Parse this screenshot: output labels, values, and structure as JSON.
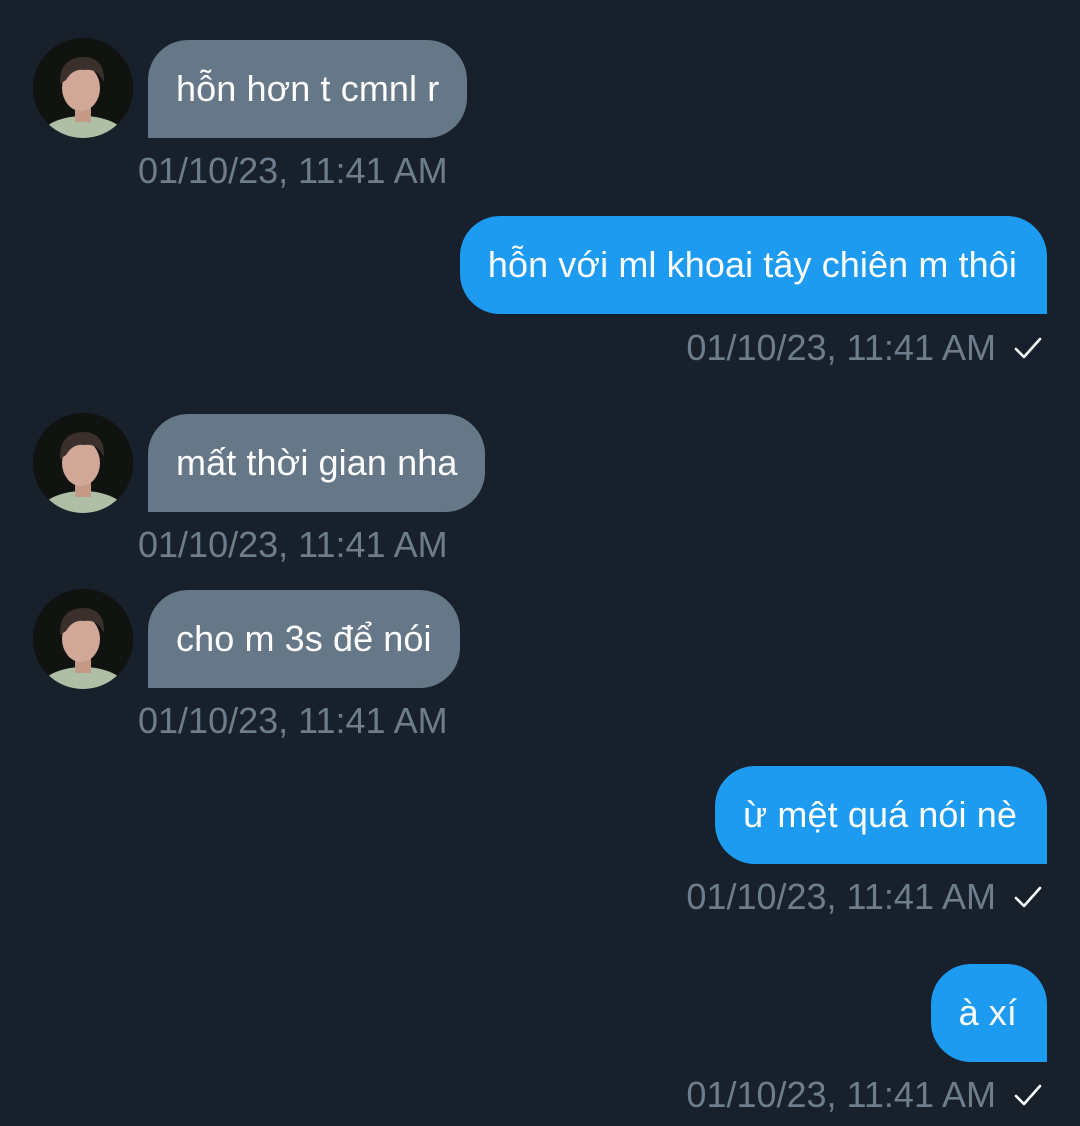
{
  "messages": [
    {
      "sender": "them",
      "text": "hỗn hơn t cmnl r",
      "timestamp": "01/10/23, 11:41 AM"
    },
    {
      "sender": "me",
      "text": "hỗn với ml khoai tây chiên m thôi",
      "timestamp": "01/10/23, 11:41 AM",
      "status_icon": "check-icon"
    },
    {
      "sender": "them",
      "text": "mất thời gian nha",
      "timestamp": "01/10/23, 11:41 AM"
    },
    {
      "sender": "them",
      "text": "cho m 3s để nói",
      "timestamp": "01/10/23, 11:41 AM"
    },
    {
      "sender": "me",
      "text": "ừ mệt quá nói nè",
      "timestamp": "01/10/23, 11:41 AM",
      "status_icon": "check-icon"
    },
    {
      "sender": "me",
      "text": "à xí",
      "timestamp": "01/10/23, 11:41 AM",
      "status_icon": "check-icon"
    }
  ],
  "colors": {
    "background": "#17202b",
    "incoming_bubble": "#667787",
    "outgoing_bubble": "#1d9bf0",
    "timestamp_text": "#6e7d8c",
    "message_text": "#ffffff"
  }
}
